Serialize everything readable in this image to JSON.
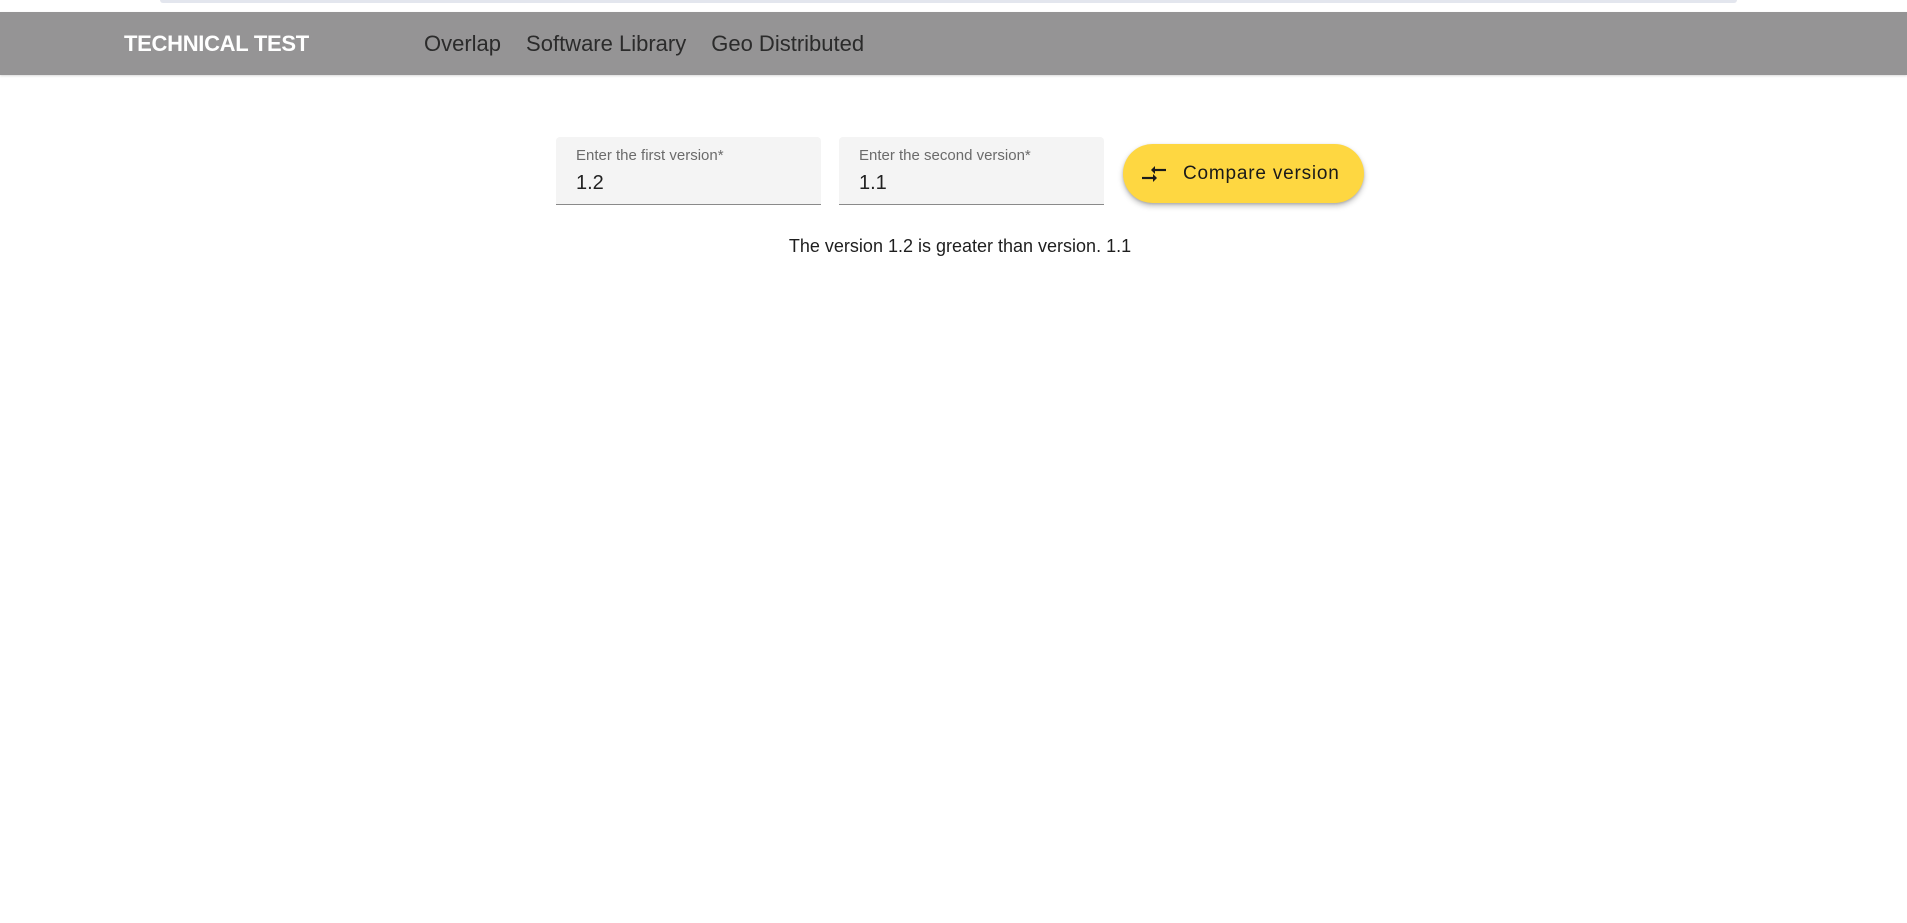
{
  "header": {
    "brand": "TECHNICAL TEST",
    "nav": [
      {
        "label": "Overlap"
      },
      {
        "label": "Software Library"
      },
      {
        "label": "Geo Distributed"
      }
    ]
  },
  "form": {
    "first_version": {
      "label": "Enter the first version*",
      "value": "1.2"
    },
    "second_version": {
      "label": "Enter the second version*",
      "value": "1.1"
    },
    "compare_button": {
      "label": "Compare version",
      "icon": "compare-arrows-icon"
    }
  },
  "result": {
    "text": "The version 1.2 is greater than version. 1.1"
  },
  "colors": {
    "navbar": "#959495",
    "button": "#fed741",
    "field_bg": "#f4f4f4"
  }
}
